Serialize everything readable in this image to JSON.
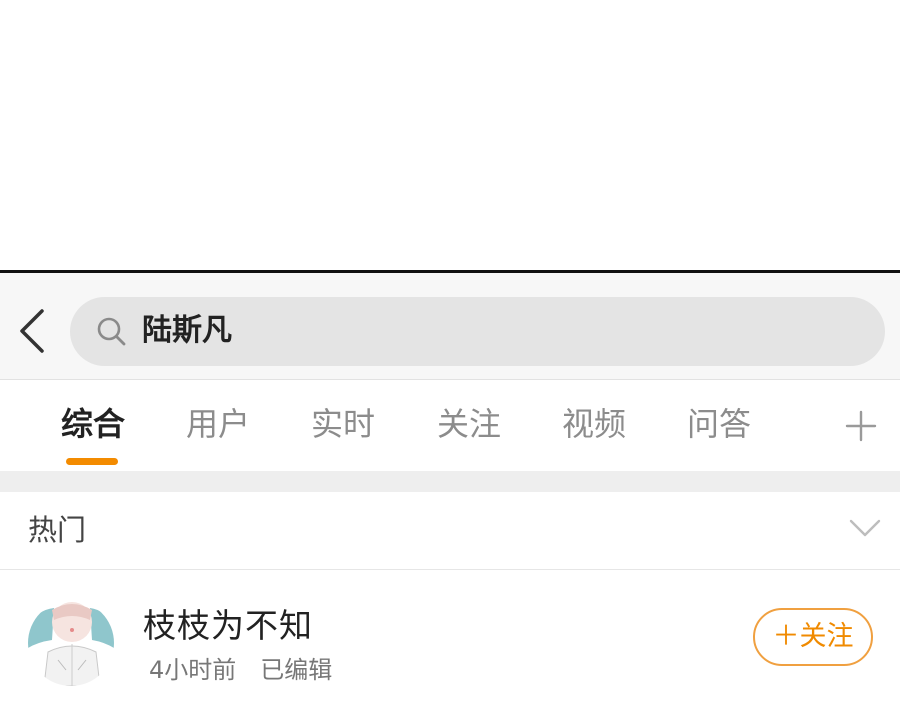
{
  "search": {
    "query": "陆斯凡"
  },
  "tabs": [
    {
      "label": "综合",
      "active": true
    },
    {
      "label": "用户",
      "active": false
    },
    {
      "label": "实时",
      "active": false
    },
    {
      "label": "关注",
      "active": false
    },
    {
      "label": "视频",
      "active": false
    },
    {
      "label": "问答",
      "active": false
    }
  ],
  "hot": {
    "label": "热门"
  },
  "result": {
    "name": "枝枝为不知",
    "time": "4小时前",
    "edited": "已编辑",
    "follow_label": "＋关注"
  },
  "colors": {
    "accent": "#f38b00",
    "follow_border": "#f0a040",
    "search_bg": "#e4e4e4"
  },
  "icons": [
    "back-arrow-icon",
    "search-icon",
    "plus-icon",
    "chevron-down-icon",
    "avatar-image"
  ]
}
